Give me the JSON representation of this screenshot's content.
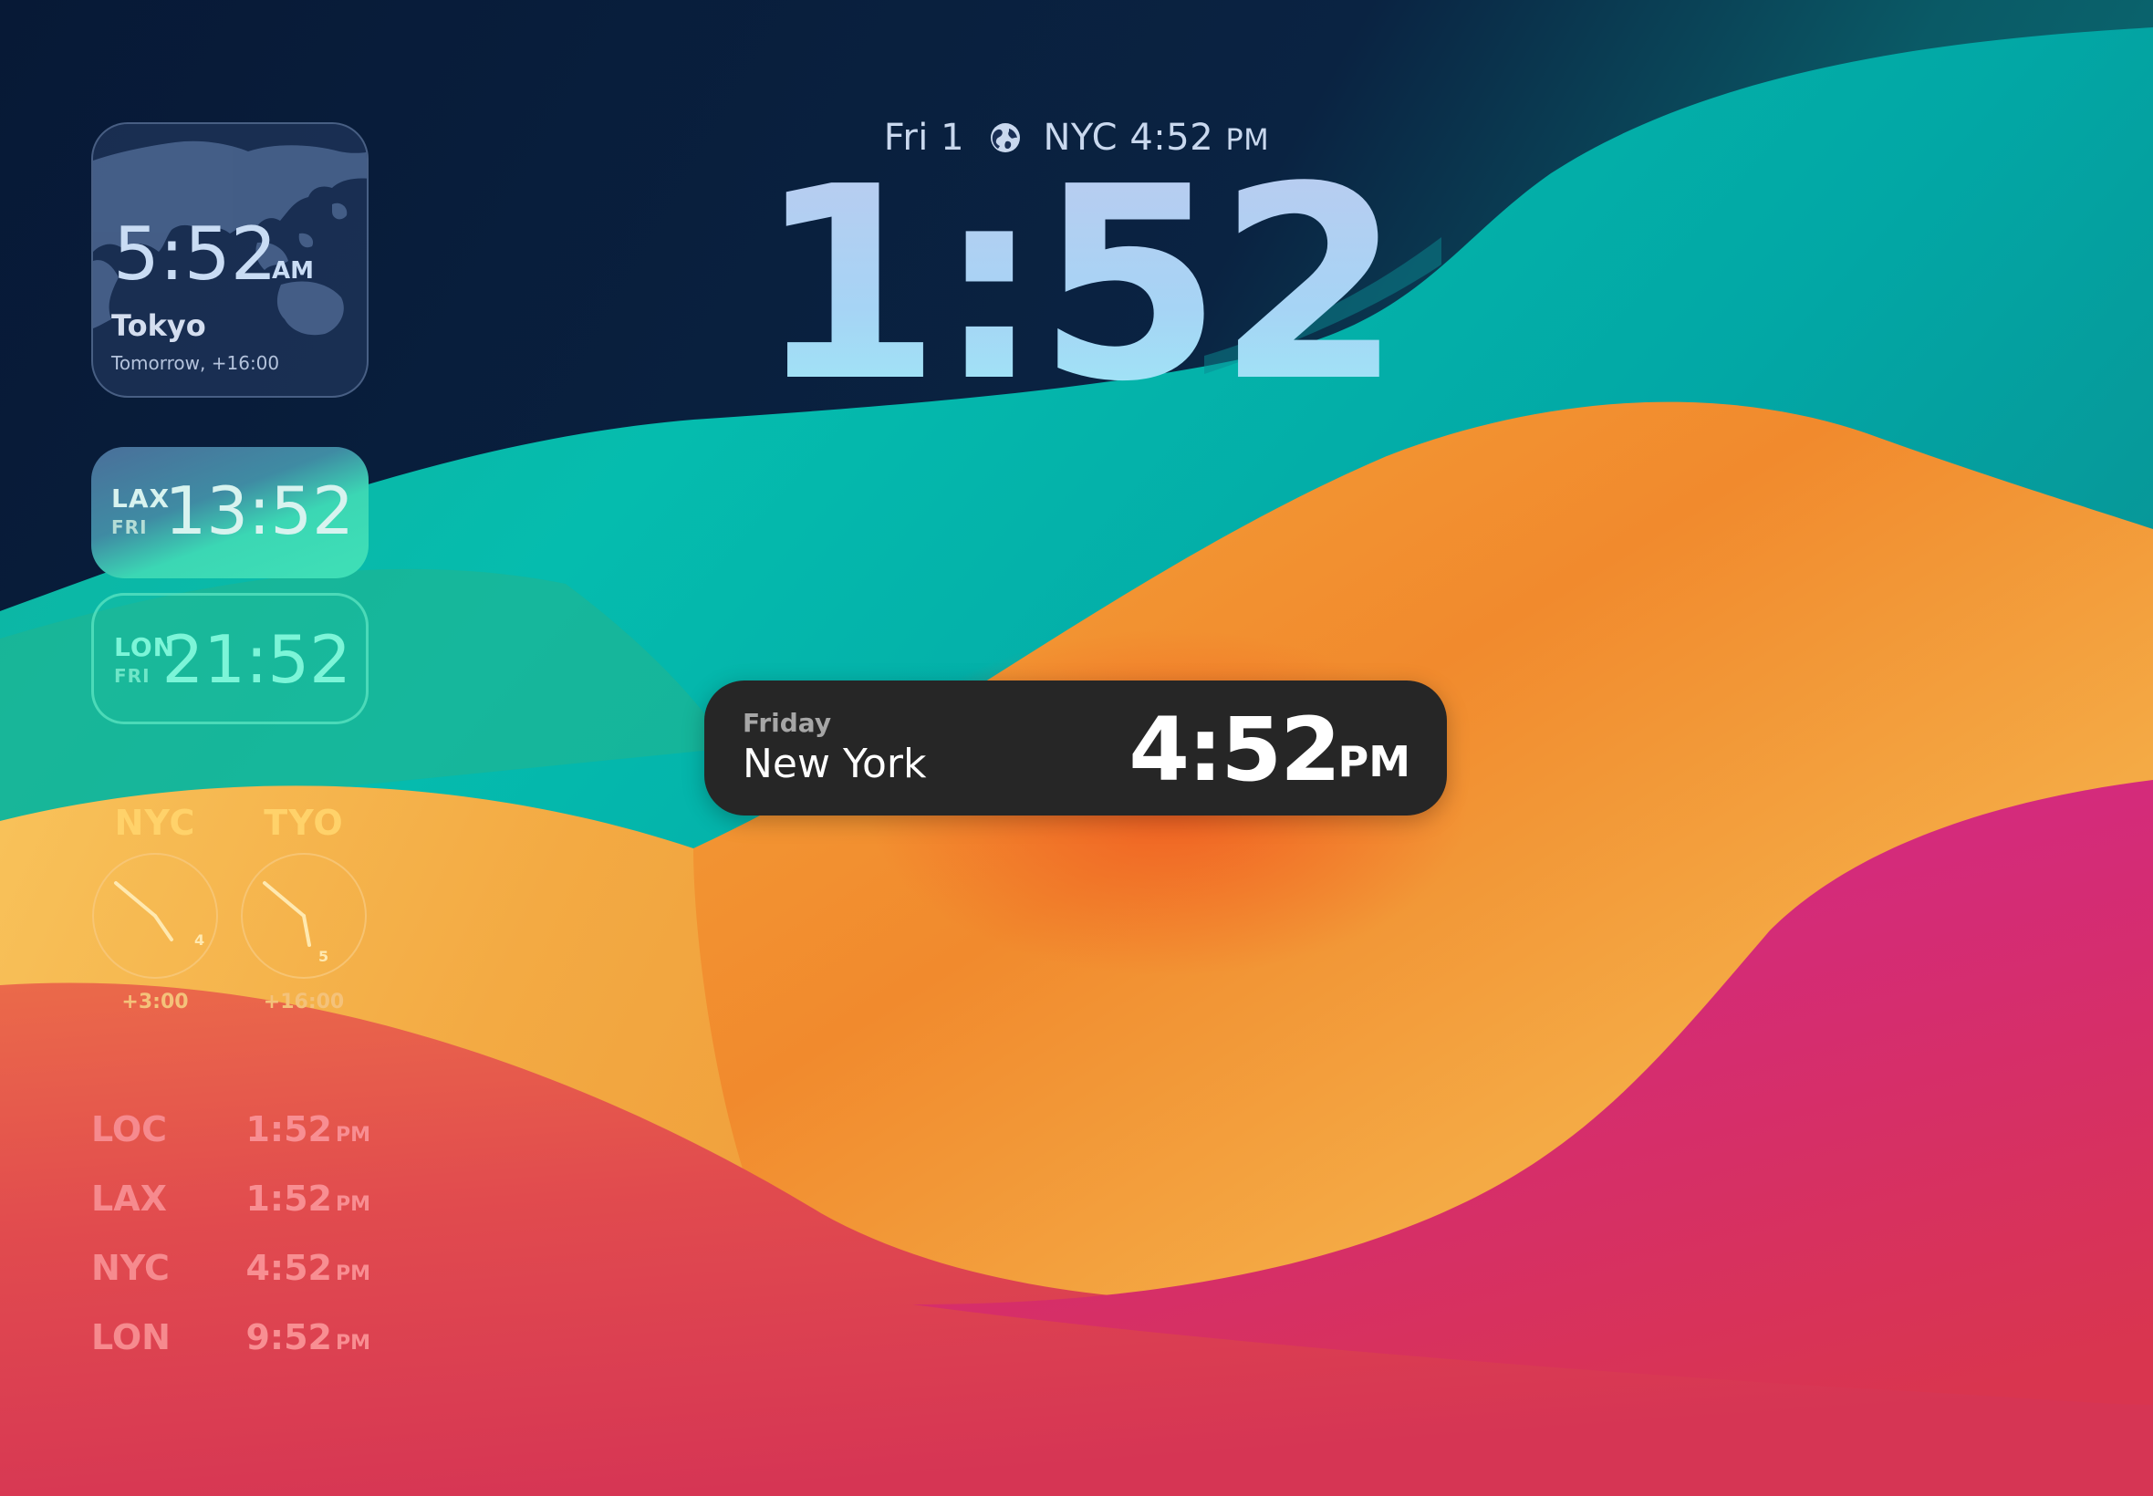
{
  "lock_screen": {
    "date": "Fri 1",
    "globe_icon": "globe-icon",
    "secondary_city": "NYC",
    "secondary_time": "4:52",
    "secondary_ampm": "PM",
    "time": "1:52"
  },
  "tokyo_widget": {
    "time": "5:52",
    "ampm": "AM",
    "city": "Tokyo",
    "subtitle": "Tomorrow, +16:00"
  },
  "digital_widgets": [
    {
      "code": "LAX",
      "day": "FRI",
      "time": "13:52"
    },
    {
      "code": "LON",
      "day": "FRI",
      "time": "21:52"
    }
  ],
  "analog_clocks": [
    {
      "code": "NYC",
      "offset": "+3:00",
      "hour_marker": "4",
      "hour": 4,
      "minute": 52
    },
    {
      "code": "TYO",
      "offset": "+16:00",
      "hour_marker": "5",
      "hour": 5,
      "minute": 52
    }
  ],
  "time_list": [
    {
      "code": "LOC",
      "time": "1:52",
      "ampm": "PM"
    },
    {
      "code": "LAX",
      "time": "1:52",
      "ampm": "PM"
    },
    {
      "code": "NYC",
      "time": "4:52",
      "ampm": "PM"
    },
    {
      "code": "LON",
      "time": "9:52",
      "ampm": "PM"
    }
  ],
  "live_activity": {
    "day": "Friday",
    "city": "New York",
    "time": "4:52",
    "ampm": "PM"
  },
  "colors": {
    "navy": "#071a3a",
    "teal": "#0ab7b0",
    "orange": "#f19a2e",
    "magenta": "#d02a86",
    "red": "#de3a4e",
    "pill": "#262626"
  }
}
